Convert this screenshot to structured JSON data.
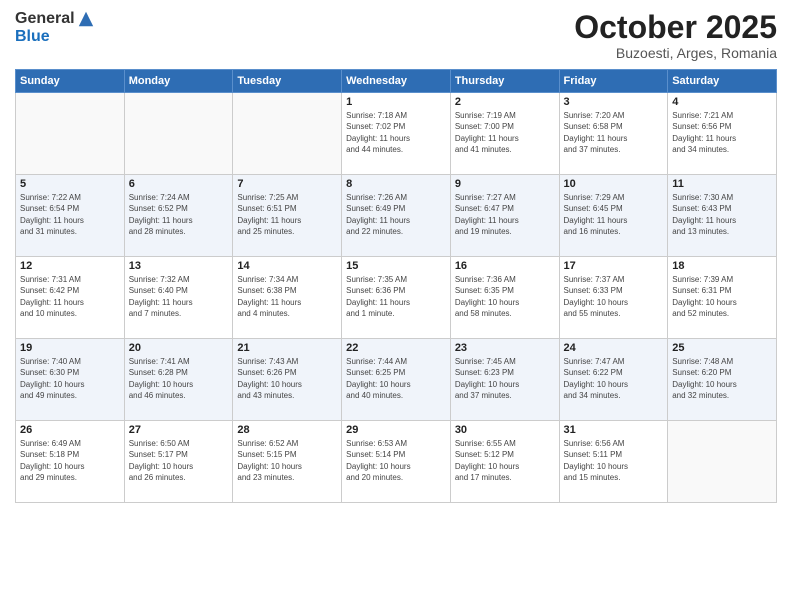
{
  "header": {
    "logo_general": "General",
    "logo_blue": "Blue",
    "month_title": "October 2025",
    "location": "Buzoesti, Arges, Romania"
  },
  "days_of_week": [
    "Sunday",
    "Monday",
    "Tuesday",
    "Wednesday",
    "Thursday",
    "Friday",
    "Saturday"
  ],
  "weeks": [
    {
      "days": [
        {
          "number": "",
          "info": ""
        },
        {
          "number": "",
          "info": ""
        },
        {
          "number": "",
          "info": ""
        },
        {
          "number": "1",
          "info": "Sunrise: 7:18 AM\nSunset: 7:02 PM\nDaylight: 11 hours\nand 44 minutes."
        },
        {
          "number": "2",
          "info": "Sunrise: 7:19 AM\nSunset: 7:00 PM\nDaylight: 11 hours\nand 41 minutes."
        },
        {
          "number": "3",
          "info": "Sunrise: 7:20 AM\nSunset: 6:58 PM\nDaylight: 11 hours\nand 37 minutes."
        },
        {
          "number": "4",
          "info": "Sunrise: 7:21 AM\nSunset: 6:56 PM\nDaylight: 11 hours\nand 34 minutes."
        }
      ]
    },
    {
      "days": [
        {
          "number": "5",
          "info": "Sunrise: 7:22 AM\nSunset: 6:54 PM\nDaylight: 11 hours\nand 31 minutes."
        },
        {
          "number": "6",
          "info": "Sunrise: 7:24 AM\nSunset: 6:52 PM\nDaylight: 11 hours\nand 28 minutes."
        },
        {
          "number": "7",
          "info": "Sunrise: 7:25 AM\nSunset: 6:51 PM\nDaylight: 11 hours\nand 25 minutes."
        },
        {
          "number": "8",
          "info": "Sunrise: 7:26 AM\nSunset: 6:49 PM\nDaylight: 11 hours\nand 22 minutes."
        },
        {
          "number": "9",
          "info": "Sunrise: 7:27 AM\nSunset: 6:47 PM\nDaylight: 11 hours\nand 19 minutes."
        },
        {
          "number": "10",
          "info": "Sunrise: 7:29 AM\nSunset: 6:45 PM\nDaylight: 11 hours\nand 16 minutes."
        },
        {
          "number": "11",
          "info": "Sunrise: 7:30 AM\nSunset: 6:43 PM\nDaylight: 11 hours\nand 13 minutes."
        }
      ]
    },
    {
      "days": [
        {
          "number": "12",
          "info": "Sunrise: 7:31 AM\nSunset: 6:42 PM\nDaylight: 11 hours\nand 10 minutes."
        },
        {
          "number": "13",
          "info": "Sunrise: 7:32 AM\nSunset: 6:40 PM\nDaylight: 11 hours\nand 7 minutes."
        },
        {
          "number": "14",
          "info": "Sunrise: 7:34 AM\nSunset: 6:38 PM\nDaylight: 11 hours\nand 4 minutes."
        },
        {
          "number": "15",
          "info": "Sunrise: 7:35 AM\nSunset: 6:36 PM\nDaylight: 11 hours\nand 1 minute."
        },
        {
          "number": "16",
          "info": "Sunrise: 7:36 AM\nSunset: 6:35 PM\nDaylight: 10 hours\nand 58 minutes."
        },
        {
          "number": "17",
          "info": "Sunrise: 7:37 AM\nSunset: 6:33 PM\nDaylight: 10 hours\nand 55 minutes."
        },
        {
          "number": "18",
          "info": "Sunrise: 7:39 AM\nSunset: 6:31 PM\nDaylight: 10 hours\nand 52 minutes."
        }
      ]
    },
    {
      "days": [
        {
          "number": "19",
          "info": "Sunrise: 7:40 AM\nSunset: 6:30 PM\nDaylight: 10 hours\nand 49 minutes."
        },
        {
          "number": "20",
          "info": "Sunrise: 7:41 AM\nSunset: 6:28 PM\nDaylight: 10 hours\nand 46 minutes."
        },
        {
          "number": "21",
          "info": "Sunrise: 7:43 AM\nSunset: 6:26 PM\nDaylight: 10 hours\nand 43 minutes."
        },
        {
          "number": "22",
          "info": "Sunrise: 7:44 AM\nSunset: 6:25 PM\nDaylight: 10 hours\nand 40 minutes."
        },
        {
          "number": "23",
          "info": "Sunrise: 7:45 AM\nSunset: 6:23 PM\nDaylight: 10 hours\nand 37 minutes."
        },
        {
          "number": "24",
          "info": "Sunrise: 7:47 AM\nSunset: 6:22 PM\nDaylight: 10 hours\nand 34 minutes."
        },
        {
          "number": "25",
          "info": "Sunrise: 7:48 AM\nSunset: 6:20 PM\nDaylight: 10 hours\nand 32 minutes."
        }
      ]
    },
    {
      "days": [
        {
          "number": "26",
          "info": "Sunrise: 6:49 AM\nSunset: 5:18 PM\nDaylight: 10 hours\nand 29 minutes."
        },
        {
          "number": "27",
          "info": "Sunrise: 6:50 AM\nSunset: 5:17 PM\nDaylight: 10 hours\nand 26 minutes."
        },
        {
          "number": "28",
          "info": "Sunrise: 6:52 AM\nSunset: 5:15 PM\nDaylight: 10 hours\nand 23 minutes."
        },
        {
          "number": "29",
          "info": "Sunrise: 6:53 AM\nSunset: 5:14 PM\nDaylight: 10 hours\nand 20 minutes."
        },
        {
          "number": "30",
          "info": "Sunrise: 6:55 AM\nSunset: 5:12 PM\nDaylight: 10 hours\nand 17 minutes."
        },
        {
          "number": "31",
          "info": "Sunrise: 6:56 AM\nSunset: 5:11 PM\nDaylight: 10 hours\nand 15 minutes."
        },
        {
          "number": "",
          "info": ""
        }
      ]
    }
  ]
}
